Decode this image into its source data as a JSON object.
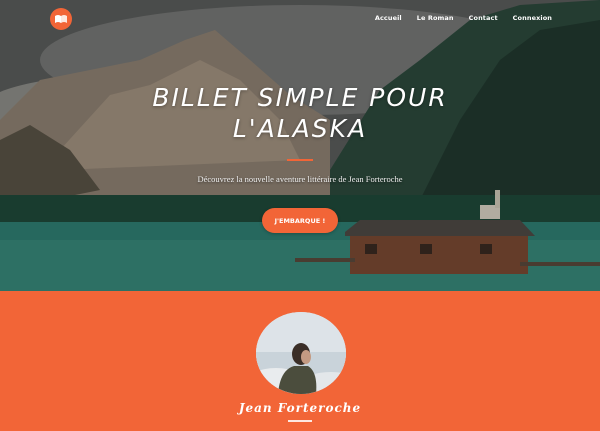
{
  "header": {
    "logo_icon": "open-book-icon",
    "nav": [
      {
        "label": "Accueil"
      },
      {
        "label": "Le Roman"
      },
      {
        "label": "Contact"
      },
      {
        "label": "Connexion"
      }
    ]
  },
  "hero": {
    "title_line1": "Billet simple pour",
    "title_line2": "l'Alaska",
    "subtitle": "Découvrez la nouvelle aventure littéraire de Jean Forteroche",
    "cta_label": "J'EMBARQUE !"
  },
  "about": {
    "author_name": "Jean Forteroche"
  },
  "colors": {
    "accent": "#f26537",
    "text_on_dark": "#ffffff"
  }
}
